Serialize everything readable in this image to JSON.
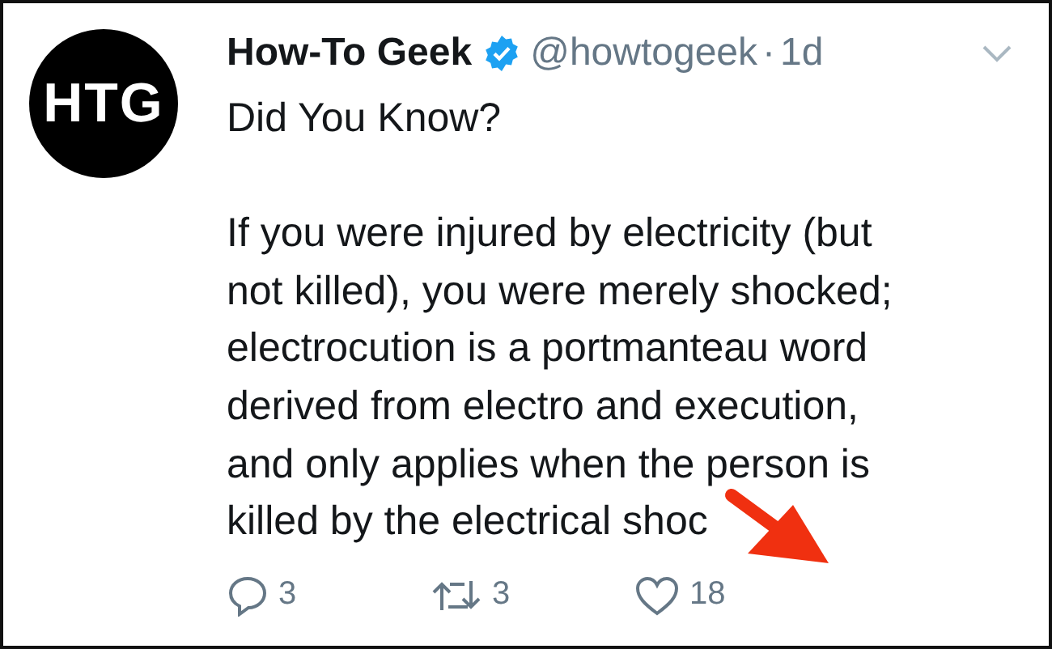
{
  "tweet": {
    "avatar": {
      "text": "HTG"
    },
    "name": "How-To Geek",
    "verified": true,
    "handle": "@howtogeek",
    "separator": "·",
    "time": "1d",
    "intro": "Did You Know?",
    "body_lines": [
      "If you were injured by electricity (but",
      "not killed), you were merely shocked;",
      "electrocution is a portmanteau word",
      "derived from electro and execution,",
      "and only applies when the person is",
      "killed by the electrical shoc"
    ],
    "actions": [
      {
        "kind": "reply",
        "count": "3"
      },
      {
        "kind": "retweet",
        "count": "3"
      },
      {
        "kind": "like",
        "count": "18"
      }
    ]
  }
}
